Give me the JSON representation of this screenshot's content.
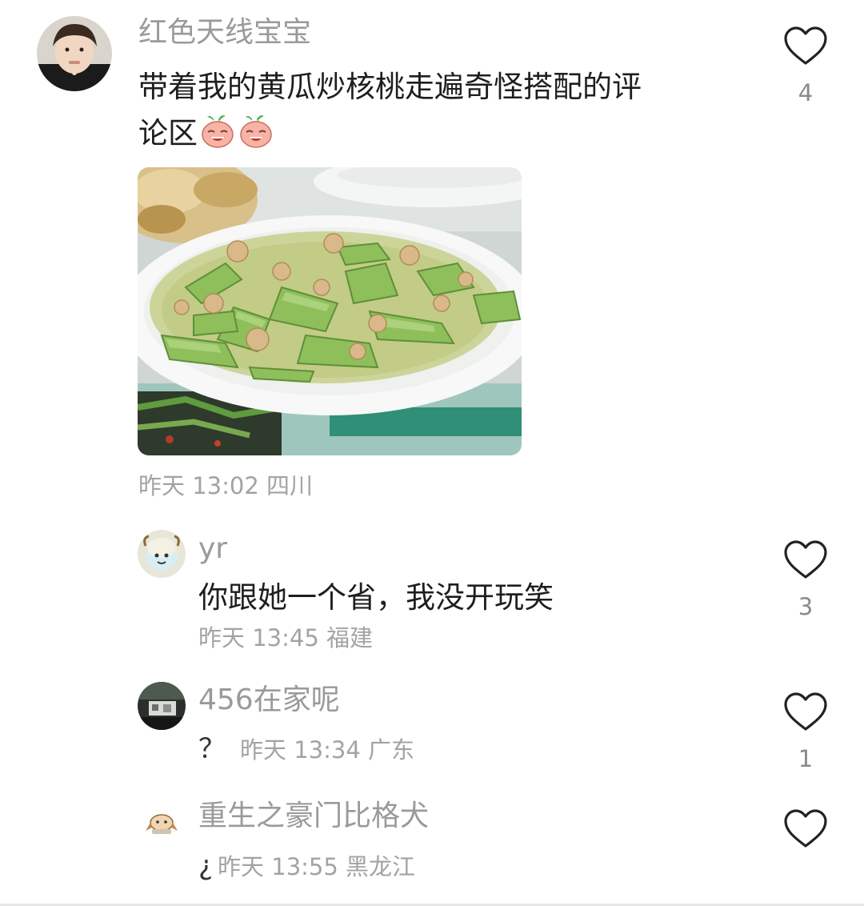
{
  "comments": {
    "main": {
      "username": "红色天线宝宝",
      "text_line1": "带着我的黄瓜炒核桃走遍奇怪搭配的评",
      "text_line2": "论区",
      "meta": "昨天 13:02 四川",
      "like_count": "4"
    },
    "reply1": {
      "username": "yr",
      "text": "你跟她一个省，我没开玩笑",
      "meta": "昨天 13:45 福建",
      "like_count": "3"
    },
    "reply2": {
      "username": "456在家呢",
      "text": "？",
      "meta": "昨天 13:34 广东",
      "like_count": "1"
    },
    "reply3": {
      "username": "重生之豪门比格犬",
      "text": "¿",
      "meta": "昨天 13:55 黑龙江"
    }
  },
  "icons": {
    "like": "heart-outline-icon",
    "emoji": "laughing-radish-emoji"
  },
  "colors": {
    "username": "#9a9a9a",
    "meta": "#a3a3a3",
    "text": "#1e1e1e",
    "heart_stroke": "#222222"
  }
}
